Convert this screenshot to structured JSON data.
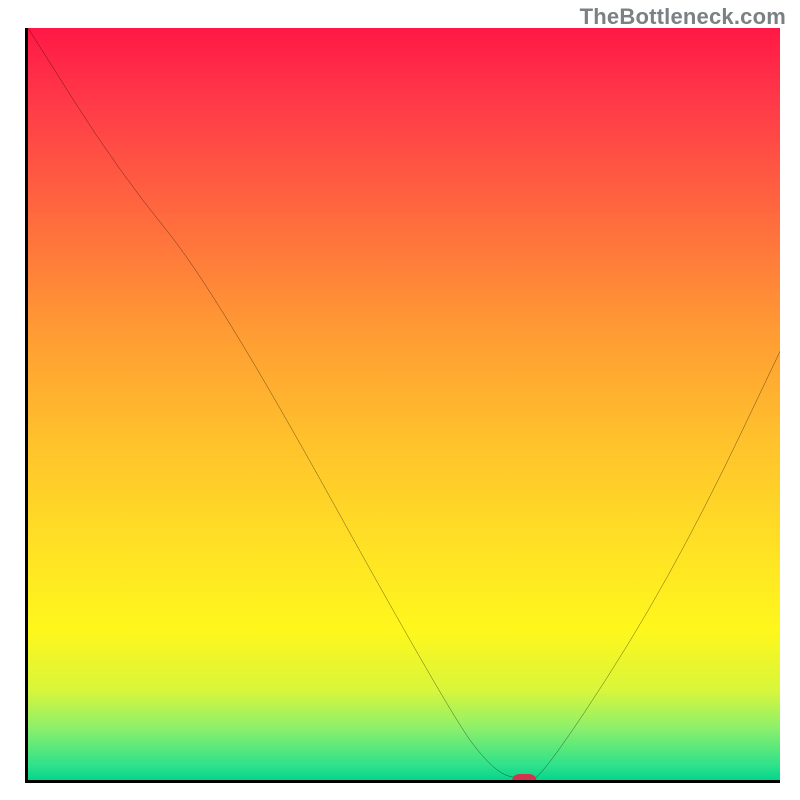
{
  "attribution": "TheBottleneck.com",
  "chart_data": {
    "type": "line",
    "title": "",
    "xlabel": "",
    "ylabel": "",
    "xlim": [
      0,
      100
    ],
    "ylim": [
      0,
      100
    ],
    "x": [
      0,
      12,
      25,
      56,
      62,
      66,
      68,
      80,
      90,
      100
    ],
    "y": [
      100,
      81,
      65,
      9,
      1,
      0,
      0,
      18,
      36,
      57
    ],
    "gradient_top_color": "#ff1846",
    "gradient_bottom_color": "#05d58d",
    "marker": {
      "x": 66,
      "y": 0,
      "color": "#d2344d"
    }
  }
}
